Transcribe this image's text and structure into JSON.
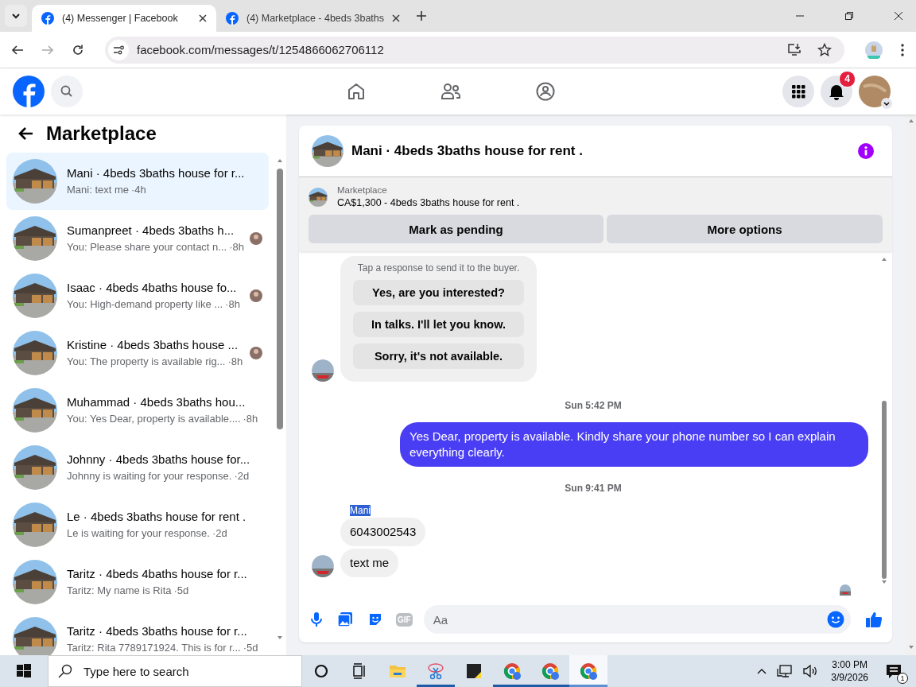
{
  "browser": {
    "tabs": [
      {
        "title": "(4) Messenger | Facebook",
        "selected": true
      },
      {
        "title": "(4) Marketplace - 4beds 3baths",
        "selected": false
      }
    ],
    "url": "facebook.com/messages/t/1254866062706112"
  },
  "header": {
    "notification_count": "4"
  },
  "sidebar": {
    "title": "Marketplace",
    "conversations": [
      {
        "title": "Mani · 4beds 3baths house for r...",
        "preview": "Mani: text me",
        "time": "·4h",
        "selected": true,
        "seen": false
      },
      {
        "title": "Sumanpreet · 4beds 3baths h...",
        "preview": "You: Please share your contact n...",
        "time": "·8h",
        "selected": false,
        "seen": true
      },
      {
        "title": "Isaac · 4beds 4baths house fo...",
        "preview": "You: High-demand property like ...",
        "time": "·8h",
        "selected": false,
        "seen": true
      },
      {
        "title": "Kristine · 4beds 3baths house ...",
        "preview": "You: The property is available rig...",
        "time": "·8h",
        "selected": false,
        "seen": true
      },
      {
        "title": "Muhammad · 4beds 3baths hou...",
        "preview": "You: Yes Dear, property is available....",
        "time": "·8h",
        "selected": false,
        "seen": false
      },
      {
        "title": "Johnny · 4beds 3baths house for...",
        "preview": "Johnny is waiting for your response.",
        "time": "·2d",
        "selected": false,
        "seen": false
      },
      {
        "title": "Le · 4beds 3baths house for rent .",
        "preview": "Le is waiting for your response.",
        "time": "·2d",
        "selected": false,
        "seen": false
      },
      {
        "title": "Taritz · 4beds 4baths house for r...",
        "preview": "Taritz: My name is Rita",
        "time": "·5d",
        "selected": false,
        "seen": false
      },
      {
        "title": "Taritz · 4beds 3baths house for r...",
        "preview": "Taritz: Rita 7789171924. This is for r...",
        "time": "·5d",
        "selected": false,
        "seen": false
      }
    ]
  },
  "chat": {
    "title": "Mani · 4beds 3baths house for rent .",
    "listing": {
      "label": "Marketplace",
      "text": "CA$1,300 - 4beds 3baths house for rent ."
    },
    "actions": [
      "Mark as pending",
      "More options"
    ],
    "messages": [
      {
        "kind": "quick_replies",
        "hint": "Tap a response to send it to the buyer.",
        "options": [
          "Yes, are you interested?",
          "In talks. I'll let you know.",
          "Sorry, it's not available."
        ],
        "avatar": true
      },
      {
        "kind": "timestamp",
        "text": "Sun 5:42 PM"
      },
      {
        "kind": "outgoing",
        "text": "Yes Dear, property is available. Kindly share your phone number so I can explain everything clearly."
      },
      {
        "kind": "timestamp",
        "text": "Sun 9:41 PM"
      },
      {
        "kind": "sender",
        "text": "Mani",
        "highlighted": true
      },
      {
        "kind": "incoming",
        "text": "6043002543",
        "avatar": false
      },
      {
        "kind": "incoming",
        "text": "text me",
        "avatar": true
      }
    ],
    "seen": true,
    "gif_label": "GIF",
    "composer": {
      "placeholder": "Aa"
    }
  },
  "taskbar": {
    "search_placeholder": "Type here to search",
    "apps": [
      {
        "kind": "cortana",
        "running": false,
        "active": false
      },
      {
        "kind": "taskview",
        "running": false,
        "active": false
      },
      {
        "kind": "explorer",
        "running": false,
        "active": false
      },
      {
        "kind": "snipping",
        "running": true,
        "active": false
      },
      {
        "kind": "sticky",
        "running": false,
        "active": false
      },
      {
        "kind": "chrome",
        "running": true,
        "active": false
      },
      {
        "kind": "chrome",
        "running": true,
        "active": false
      },
      {
        "kind": "chrome",
        "running": true,
        "active": true
      }
    ],
    "time": "3:00 PM",
    "date": "3/9/2026",
    "notification_count": "1"
  }
}
